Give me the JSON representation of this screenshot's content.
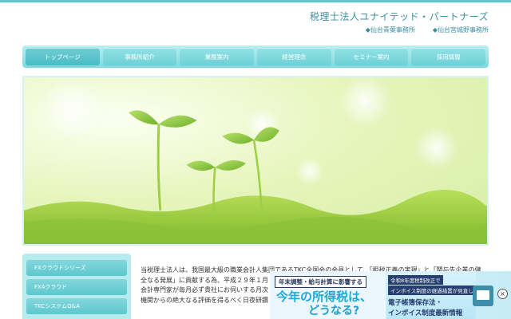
{
  "header": {
    "title": "税理士法人ユナイテッド・パートナーズ",
    "offices": [
      "◆仙台青葉事務所",
      "◆仙台宮城野事務所"
    ]
  },
  "nav": {
    "items": [
      "トップページ",
      "事務所紹介",
      "業務案内",
      "経営理念",
      "セミナー案内",
      "採用情報"
    ]
  },
  "sidebar": {
    "items": [
      "FXクラウドシリーズ",
      "FX4クラウド",
      "TKCシステムQ&A"
    ]
  },
  "intro": {
    "line1": "当税理士法人は、我国最大級の職業会計人集団であるTKC全国会の会員として、「租税正義の実現」と「関与先企業の健",
    "line2": "全なる発展」に貢献する為、平成２９年１月",
    "line3": "会計専門家が毎月必ず貴社にお伺いする月次",
    "line4": "機関からの絶大なる評価を得るべく日夜研鑽"
  },
  "banner": {
    "tag": "年末調整・給与計算に影響する",
    "big1": "今年の所得税は、",
    "big2": "どうなる?",
    "r1": "令和8年度税制改正で",
    "r2": "インボイス制度の経過措置が見直し",
    "r3": "電子帳簿保存法・",
    "r4": "インボイス制度最新情報",
    "close": "×"
  }
}
